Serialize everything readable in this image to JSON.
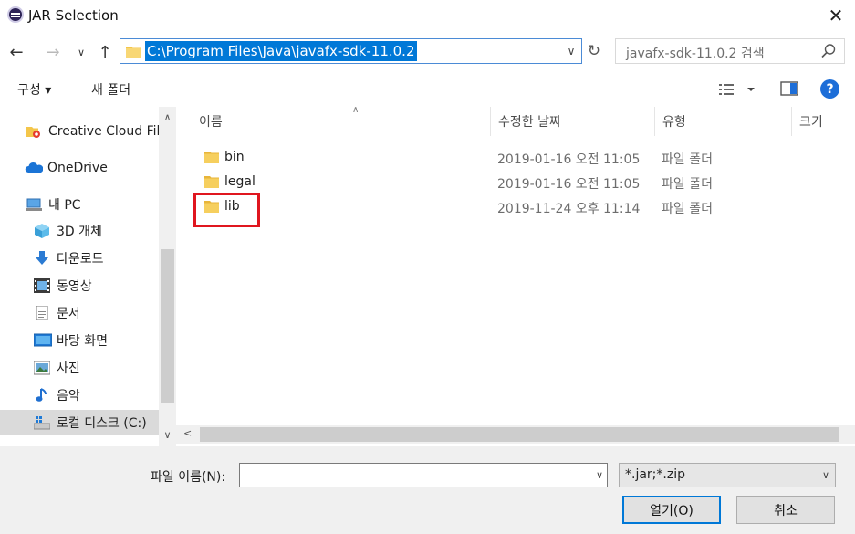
{
  "window": {
    "title": "JAR Selection",
    "close_label": "✕"
  },
  "nav": {
    "address": "C:\\Program Files\\Java\\javafx-sdk-11.0.2",
    "search_placeholder": "javafx-sdk-11.0.2 검색"
  },
  "toolbar": {
    "organize_label": "구성 ▾",
    "newfolder_label": "새 폴더",
    "help_label": "?"
  },
  "sidebar": {
    "items": [
      {
        "label": "Creative Cloud Fil",
        "icon": "creative-cloud-icon"
      },
      {
        "label": "OneDrive",
        "icon": "onedrive-icon"
      },
      {
        "label": "내 PC",
        "icon": "computer-icon"
      },
      {
        "label": "3D 개체",
        "icon": "3d-objects-icon"
      },
      {
        "label": "다운로드",
        "icon": "download-icon"
      },
      {
        "label": "동영상",
        "icon": "video-icon"
      },
      {
        "label": "문서",
        "icon": "document-icon"
      },
      {
        "label": "바탕 화면",
        "icon": "desktop-icon"
      },
      {
        "label": "사진",
        "icon": "pictures-icon"
      },
      {
        "label": "음악",
        "icon": "music-icon"
      },
      {
        "label": "로컬 디스크 (C:)",
        "icon": "drive-icon",
        "selected": true
      }
    ]
  },
  "filelist": {
    "columns": [
      "이름",
      "수정한 날짜",
      "유형",
      "크기"
    ],
    "rows": [
      {
        "name": "bin",
        "date": "2019-01-16 오전 11:05",
        "type": "파일 폴더"
      },
      {
        "name": "legal",
        "date": "2019-01-16 오전 11:05",
        "type": "파일 폴더"
      },
      {
        "name": "lib",
        "date": "2019-11-24 오후 11:14",
        "type": "파일 폴더"
      }
    ]
  },
  "bottom": {
    "filename_label": "파일 이름(N):",
    "filename_value": "",
    "filter_value": "*.jar;*.zip",
    "open_label": "열기(O)",
    "cancel_label": "취소"
  },
  "colors": {
    "accent": "#0078d7",
    "highlight_box": "#e0161f",
    "folder": "#f4c64a"
  }
}
